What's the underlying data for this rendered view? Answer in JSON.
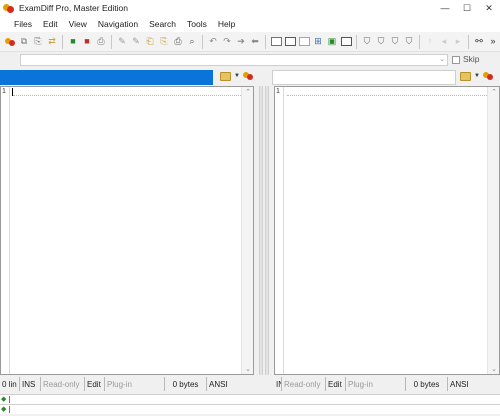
{
  "window": {
    "title": "ExamDiff Pro, Master Edition",
    "controls": {
      "minimize": "—",
      "maximize": "☐",
      "close": "✕"
    }
  },
  "menu": [
    "Files",
    "Edit",
    "View",
    "Navigation",
    "Search",
    "Tools",
    "Help"
  ],
  "filter": {
    "skip_label": "Skip"
  },
  "left_pane": {
    "line_number": "1"
  },
  "right_pane": {
    "line_number": "1"
  },
  "left_status": {
    "lines": "0 lin",
    "mode": "INS",
    "access": "Read-only",
    "edit": "Edit",
    "plugin": "Plug-in",
    "size": "0 bytes",
    "encoding": "ANSI"
  },
  "right_status": {
    "lines": "IN",
    "access": "Read-only",
    "edit": "Edit",
    "plugin": "Plug-in",
    "size": "0 bytes",
    "encoding": "ANSI"
  },
  "colors": {
    "active_path_bar": "#0a74da",
    "accent_green": "#3a9a3a"
  }
}
